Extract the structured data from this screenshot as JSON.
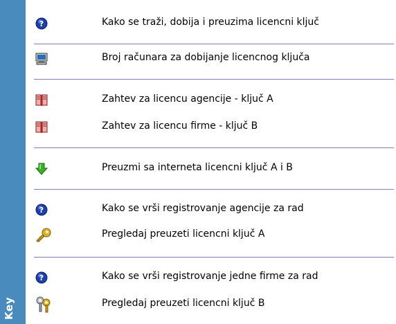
{
  "sidebar": {
    "title": "Key"
  },
  "items": [
    {
      "icon": "help-icon",
      "label": "Kako se traži, dobija i preuzima licencni ključ"
    },
    {
      "icon": "computer-icon",
      "label": "Broj računara za dobijanje licencnog ključa"
    },
    {
      "icon": "book-icon",
      "label": "Zahtev za licencu agencije - ključ A"
    },
    {
      "icon": "book-icon",
      "label": "Zahtev za licencu firme - ključ B"
    },
    {
      "icon": "download-arrow-icon",
      "label": "Preuzmi sa interneta licencni ključ A i B"
    },
    {
      "icon": "help-icon",
      "label": "Kako se vrši registrovanje agencije za rad"
    },
    {
      "icon": "key-icon",
      "label": "Pregledaj preuzeti licencni ključ A"
    },
    {
      "icon": "help-icon",
      "label": "Kako se vrši registrovanje jedne firme za rad"
    },
    {
      "icon": "keys-icon",
      "label": "Pregledaj preuzeti licencni ključ B"
    }
  ],
  "colors": {
    "sidebar": "#4a8bbd",
    "separator": "#7f7fb2",
    "help": "#1f3fa8",
    "arrow": "#3cae2a",
    "key": "#c79a18"
  }
}
